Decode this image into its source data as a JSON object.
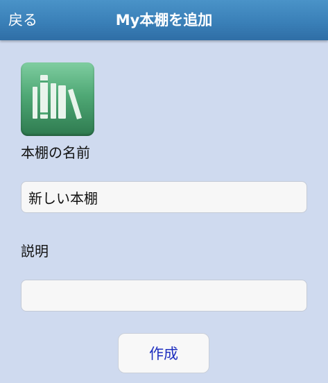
{
  "header": {
    "back_label": "戻る",
    "title": "My本棚を追加"
  },
  "app_icon": {
    "icon": "bookshelf-icon",
    "colors": {
      "top": "#7fcda0",
      "bottom": "#2e7a4f",
      "books": "#e9f4ec"
    }
  },
  "form": {
    "name_label": "本棚の名前",
    "name_value": "新しい本棚",
    "description_label": "説明",
    "description_value": "",
    "create_label": "作成"
  },
  "colors": {
    "background": "#cfdaef",
    "header": "#3a80b8",
    "button_text": "#1f2fbf"
  }
}
